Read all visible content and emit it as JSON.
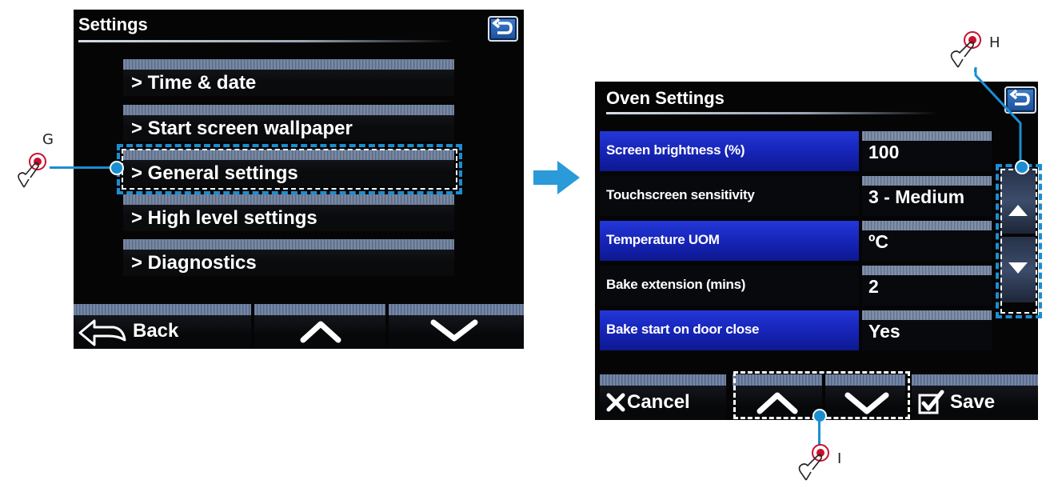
{
  "left_screen": {
    "title": "Settings",
    "menu_items": [
      {
        "label": "> Time & date"
      },
      {
        "label": "> Start screen wallpaper"
      },
      {
        "label": "> General settings"
      },
      {
        "label": "> High level settings"
      },
      {
        "label": "> Diagnostics"
      }
    ],
    "bottom_bar": {
      "back_label": "Back"
    }
  },
  "right_screen": {
    "title": "Oven Settings",
    "rows": [
      {
        "label": "Screen brightness (%)",
        "value": "100"
      },
      {
        "label": "Touchscreen sensitivity",
        "value": "3 - Medium"
      },
      {
        "label": "Temperature UOM",
        "value": "ºC"
      },
      {
        "label": "Bake extension (mins)",
        "value": "2"
      },
      {
        "label": "Bake start on door close",
        "value": "Yes"
      }
    ],
    "bottom_bar": {
      "cancel_label": "Cancel",
      "save_label": "Save"
    }
  },
  "callouts": {
    "g": "G",
    "h": "H",
    "i": "I"
  },
  "colors": {
    "accent_blue": "#1b8ed1",
    "row_blue": "#1a2bc4"
  }
}
